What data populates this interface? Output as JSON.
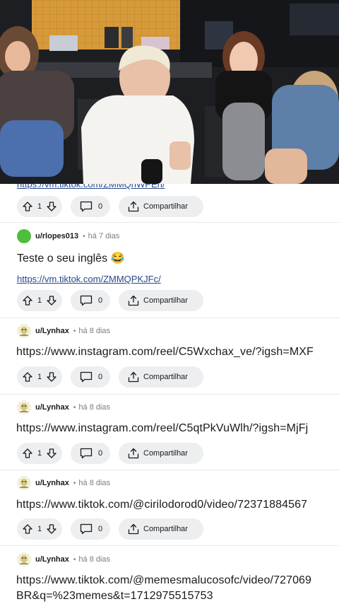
{
  "posts": [
    {
      "type": "partial",
      "link_text": "https://vm.tiktok.com/ZMMQhWPEh/",
      "upvotes": "1",
      "comments": "0",
      "share_label": "Compartilhar"
    },
    {
      "type": "text",
      "username": "u/rlopes013",
      "age": "há 7 dias",
      "title": "Teste o seu inglês 😂",
      "link_text": "https://vm.tiktok.com/ZMMQPKJFc/",
      "upvotes": "1",
      "comments": "0",
      "share_label": "Compartilhar",
      "avatar_color": "#4fbe3d"
    },
    {
      "type": "url",
      "username": "u/Lynhax",
      "age": "há 8 dias",
      "url_lines": [
        "https://www.instagram.com/reel/C5Wxchax_ve/?igsh=MXF"
      ],
      "upvotes": "1",
      "comments": "0",
      "share_label": "Compartilhar"
    },
    {
      "type": "url",
      "username": "u/Lynhax",
      "age": "há 8 dias",
      "url_lines": [
        "https://www.instagram.com/reel/C5qtPkVuWlh/?igsh=MjFj"
      ],
      "upvotes": "1",
      "comments": "0",
      "share_label": "Compartilhar"
    },
    {
      "type": "url",
      "username": "u/Lynhax",
      "age": "há 8 dias",
      "url_lines": [
        "https://www.tiktok.com/@cirilodorod0/video/72371884567"
      ],
      "upvotes": "1",
      "comments": "0",
      "share_label": "Compartilhar"
    },
    {
      "type": "url",
      "username": "u/Lynhax",
      "age": "há 8 dias",
      "url_lines": [
        "https://www.tiktok.com/@memesmalucosofc/video/727069",
        "BR&q=%23memes&t=1712975515753"
      ]
    }
  ],
  "colors": {
    "link": "#26488c",
    "pill_bg": "#eceef0",
    "divider": "#e9eaeb",
    "meta_gray": "#7c7c7c"
  },
  "icons": {
    "upvote": "arrow-up-outline-icon",
    "downvote": "arrow-down-outline-icon",
    "comment": "speech-bubble-icon",
    "share": "share-upload-icon"
  }
}
